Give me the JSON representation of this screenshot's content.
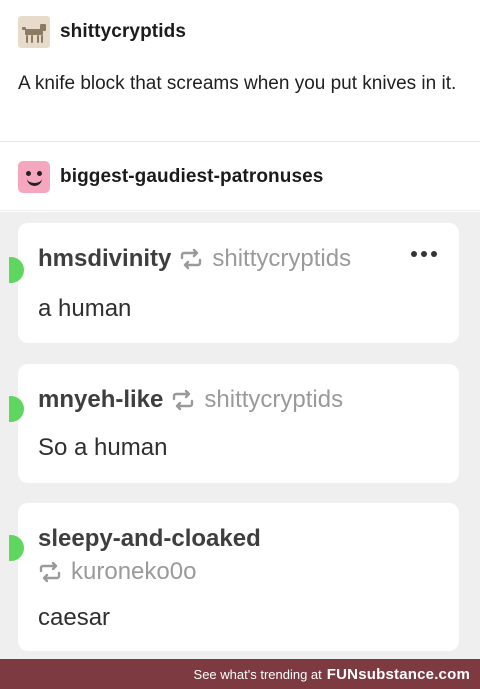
{
  "post": {
    "author": "shittycryptids",
    "text": "A knife block that screams when you put knives in it."
  },
  "reblogger": {
    "name": "biggest-gaudiest-patronuses"
  },
  "comments": [
    {
      "author": "hmsdivinity",
      "source": "shittycryptids",
      "text": "a human",
      "has_menu": true
    },
    {
      "author": "mnyeh-like",
      "source": "shittycryptids",
      "text": "So a human"
    },
    {
      "author": "sleepy-and-cloaked",
      "source": "kuroneko0o",
      "text": "caesar"
    }
  ],
  "footer": {
    "prefix": "See what's trending at",
    "brand": "FUNsubstance.com"
  },
  "colors": {
    "online_dot": "#5fd65f",
    "footer_bg": "#7d3a40",
    "comments_bg": "#efefef"
  }
}
